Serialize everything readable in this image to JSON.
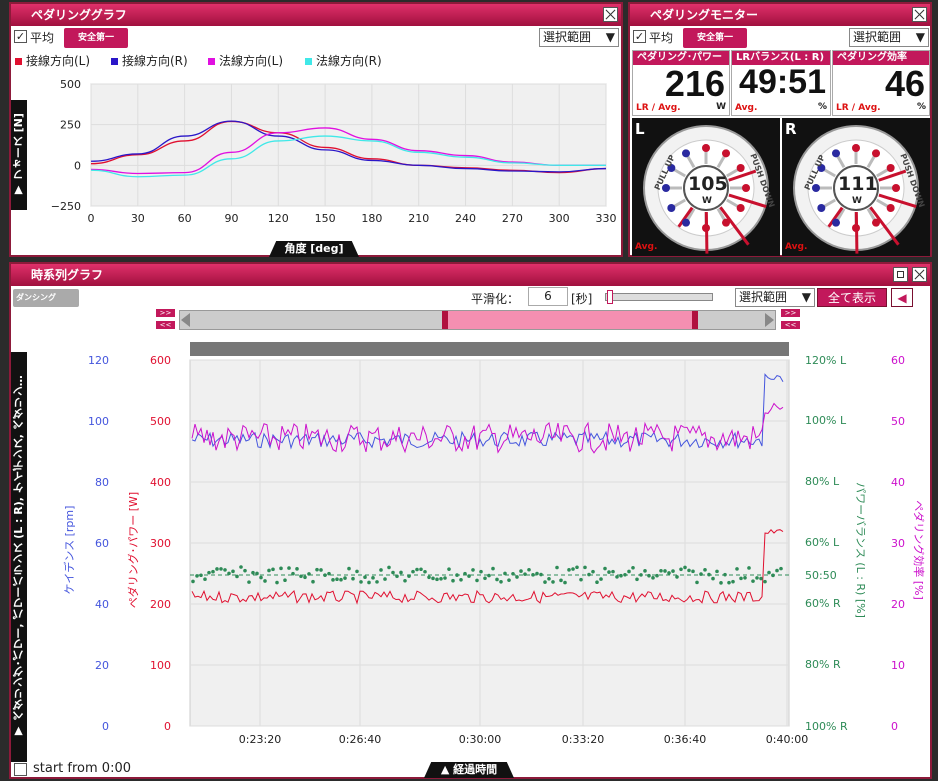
{
  "pedal_graph": {
    "title": "ペダリンググラフ",
    "avg_label": "平均",
    "logo": "安全第一",
    "select": "選択範囲",
    "legend": [
      {
        "label": "接線方向(L)",
        "color": "#e01030"
      },
      {
        "label": "接線方向(R)",
        "color": "#2a16c8"
      },
      {
        "label": "法線方向(L)",
        "color": "#e010e0"
      },
      {
        "label": "法線方向(R)",
        "color": "#40e8e8"
      }
    ],
    "y_axis_label": "▼ フォース [N]",
    "x_axis_label": "角度 [deg]",
    "chart_data": {
      "type": "line",
      "x": [
        0,
        30,
        60,
        90,
        120,
        150,
        180,
        210,
        240,
        270,
        300,
        330
      ],
      "x_ticks": [
        "0",
        "30",
        "60",
        "90",
        "120",
        "150",
        "180",
        "210",
        "240",
        "270",
        "300",
        "330"
      ],
      "y_ticks": [
        "500",
        "250",
        "0",
        "−250"
      ],
      "ylim": [
        -250,
        500
      ],
      "xlim": [
        0,
        330
      ],
      "series": [
        {
          "name": "接線方向(L)",
          "color": "#e01030",
          "values": [
            10,
            65,
            150,
            270,
            200,
            110,
            40,
            0,
            -15,
            -30,
            -45,
            -20
          ]
        },
        {
          "name": "接線方向(R)",
          "color": "#2a16c8",
          "values": [
            25,
            70,
            180,
            272,
            180,
            95,
            30,
            0,
            -20,
            -35,
            -40,
            -20
          ]
        },
        {
          "name": "法線方向(L)",
          "color": "#e010e0",
          "values": [
            -25,
            -50,
            -45,
            80,
            200,
            230,
            160,
            90,
            60,
            20,
            0,
            0
          ]
        },
        {
          "name": "法線方向(R)",
          "color": "#40e8e8",
          "values": [
            -30,
            -70,
            -60,
            40,
            150,
            180,
            150,
            80,
            50,
            15,
            0,
            0
          ]
        }
      ]
    }
  },
  "pedal_monitor": {
    "title": "ペダリングモニター",
    "avg_label": "平均",
    "logo": "安全第一",
    "select": "選択範囲",
    "metrics": [
      {
        "label": "ペダリング･パワー",
        "value": "216",
        "foot": "LR / Avg.",
        "unit": "W"
      },
      {
        "label": "LRバランス(L : R)",
        "value": "49:51",
        "foot": "Avg.",
        "unit": "%"
      },
      {
        "label": "ペダリング効率",
        "value": "46",
        "foot": "LR / Avg.",
        "unit": "%"
      }
    ],
    "left": {
      "side": "L",
      "value": "105",
      "unit": "W",
      "avg": "Avg.",
      "pull": "PULL UP",
      "push": "PUSH DOWN"
    },
    "right": {
      "side": "R",
      "value": "111",
      "unit": "W",
      "avg": "Avg.",
      "pull": "PULL UP",
      "push": "PUSH DOWN"
    }
  },
  "time_graph": {
    "title": "時系列グラフ",
    "dancing": "ダンシング",
    "smoothing_label": "平滑化：",
    "smoothing_value": "6",
    "smoothing_unit": "[秒]",
    "select": "選択範囲",
    "show_all": "全て表示",
    "y_tab": "▼ ペダリング･パワー, パワーバランス (L : R), ケイデンス, ペダリン…",
    "x_tab": "▲ 経過時間",
    "start_from": "start from 0:00",
    "cadence_axis": {
      "label": "ケイデンス [rpm]",
      "ticks": [
        "120",
        "100",
        "80",
        "60",
        "40",
        "20",
        "0"
      ],
      "color": "#4455dd"
    },
    "power_axis": {
      "label": "ペダリング･パワー [W]",
      "ticks": [
        "600",
        "500",
        "400",
        "300",
        "200",
        "100",
        "0"
      ],
      "color": "#e01030"
    },
    "balance_axis": {
      "label": "パワーバランス (L : R) [%]",
      "ticks": [
        "120% L",
        "100% L",
        "80% L",
        "60% L",
        "50:50",
        "60% R",
        "80% R",
        "100% R"
      ],
      "color": "#2e8b57"
    },
    "efficiency_axis": {
      "label": "ペダリング効率 [%]",
      "ticks": [
        "60",
        "50",
        "40",
        "30",
        "20",
        "10",
        "0"
      ],
      "color": "#cc10cc"
    },
    "x_ticks": [
      "0:23:20",
      "0:26:40",
      "0:30:00",
      "0:33:20",
      "0:36:40",
      "0:40:00"
    ],
    "chart_data": {
      "type": "line",
      "x_label": "経過時間",
      "x_range": [
        "0:20:00",
        "0:40:00"
      ],
      "series": [
        {
          "name": "ケイデンス [rpm]",
          "color": "#4455dd",
          "approx_level": 95,
          "end_spike": 112
        },
        {
          "name": "ペダリング･パワー [W]",
          "color": "#e01030",
          "approx_level": 210,
          "end_spike": 320
        },
        {
          "name": "パワーバランス (L : R) [%]",
          "color": "#2e8b57",
          "approx_level": "50:50"
        },
        {
          "name": "ペダリング効率 [%]",
          "color": "#cc10cc",
          "approx_level": 47,
          "end_spike": 55
        }
      ]
    }
  }
}
